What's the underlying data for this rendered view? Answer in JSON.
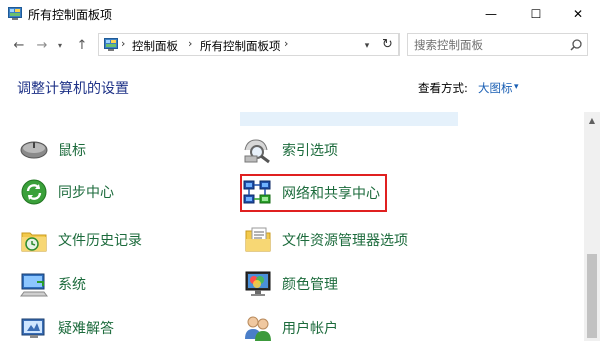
{
  "window": {
    "title": "所有控制面板项",
    "controls": {
      "minimize": "—",
      "maximize": "☐",
      "close": "✕"
    }
  },
  "nav": {
    "back": "←",
    "forward": "→",
    "recent": "▾",
    "up": "↑",
    "breadcrumb": [
      "控制面板",
      "所有控制面板项"
    ],
    "separator": "›",
    "dropdown": "▾",
    "refresh": "↻",
    "search_placeholder": "搜索控制面板"
  },
  "header": {
    "title": "调整计算机的设置",
    "view_by_label": "查看方式:",
    "view_by_value": "大图标",
    "view_dropdown": "▾"
  },
  "items": {
    "mouse": "鼠标",
    "indexing": "索引选项",
    "sync": "同步中心",
    "network": "网络和共享中心",
    "file_history": "文件历史记录",
    "explorer_options": "文件资源管理器选项",
    "system": "系统",
    "color_mgmt": "颜色管理",
    "troubleshoot": "疑难解答",
    "user_accounts": "用户帐户"
  },
  "selected_item": "网络和共享中心",
  "colors": {
    "link_green": "#1c6b3c",
    "header_blue": "#1e3287",
    "view_blue": "#1a5fb4",
    "selection_red": "#e02020"
  }
}
